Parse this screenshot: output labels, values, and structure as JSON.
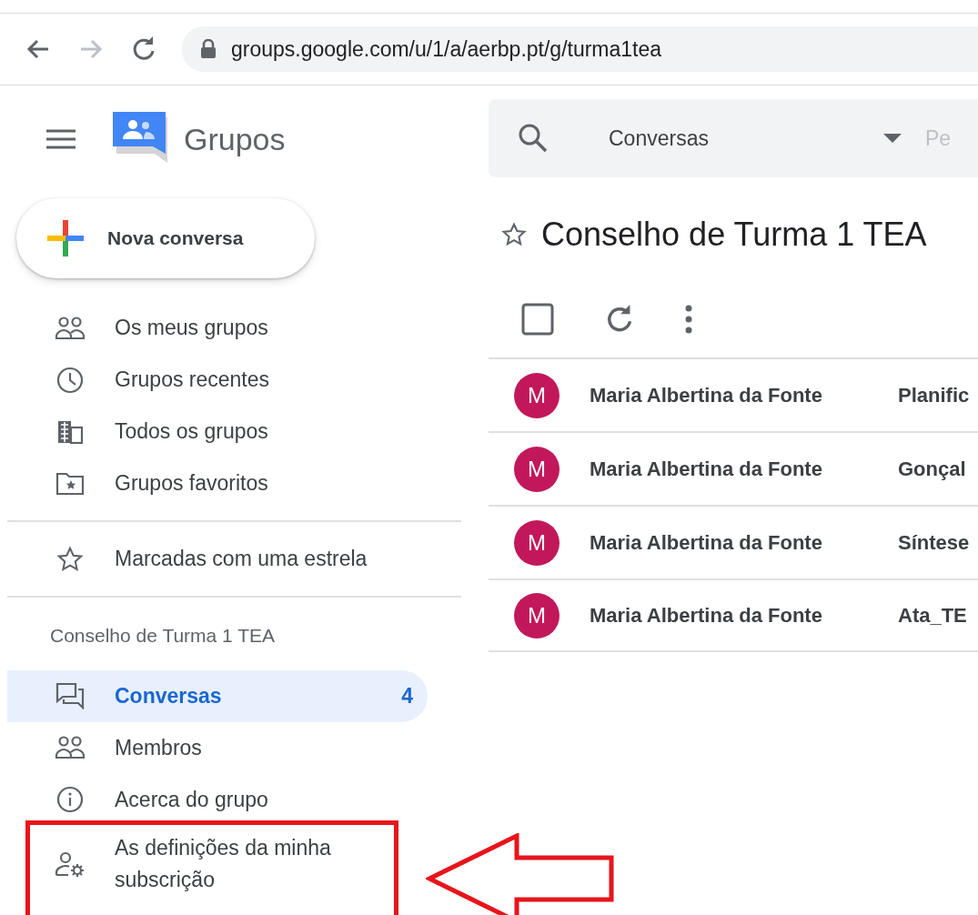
{
  "browser": {
    "url": "groups.google.com/u/1/a/aerbp.pt/g/turma1tea"
  },
  "app": {
    "name": "Grupos"
  },
  "search": {
    "scope": "Conversas",
    "placeholder": "Pe"
  },
  "new_button": {
    "label": "Nova conversa"
  },
  "nav": [
    {
      "label": "Os meus grupos",
      "kind": "people"
    },
    {
      "label": "Grupos recentes",
      "kind": "clock"
    },
    {
      "label": "Todos os grupos",
      "kind": "building"
    },
    {
      "label": "Grupos favoritos",
      "kind": "folder-star"
    }
  ],
  "starred": {
    "label": "Marcadas com uma estrela",
    "kind": "star"
  },
  "group_section": {
    "title": "Conselho de Turma 1 TEA",
    "items": [
      {
        "label": "Conversas",
        "count": "4",
        "kind": "chat",
        "selected": true,
        "highlighted": false
      },
      {
        "label": "Membros",
        "kind": "people",
        "selected": false,
        "highlighted": false
      },
      {
        "label": "Acerca do grupo",
        "kind": "info",
        "selected": false,
        "highlighted": false
      },
      {
        "label": "As definições da minha subscrição",
        "kind": "person-gear",
        "selected": false,
        "highlighted": true
      }
    ]
  },
  "main": {
    "title": "Conselho de Turma 1 TEA",
    "select_all_checked": false,
    "conversations": [
      {
        "avatar": "M",
        "author": "Maria Albertina da Fonte",
        "subject": "Planific"
      },
      {
        "avatar": "M",
        "author": "Maria Albertina da Fonte",
        "subject": "Gonçal"
      },
      {
        "avatar": "M",
        "author": "Maria Albertina da Fonte",
        "subject": "Síntese"
      },
      {
        "avatar": "M",
        "author": "Maria Albertina da Fonte",
        "subject": "Ata_TE"
      }
    ]
  }
}
